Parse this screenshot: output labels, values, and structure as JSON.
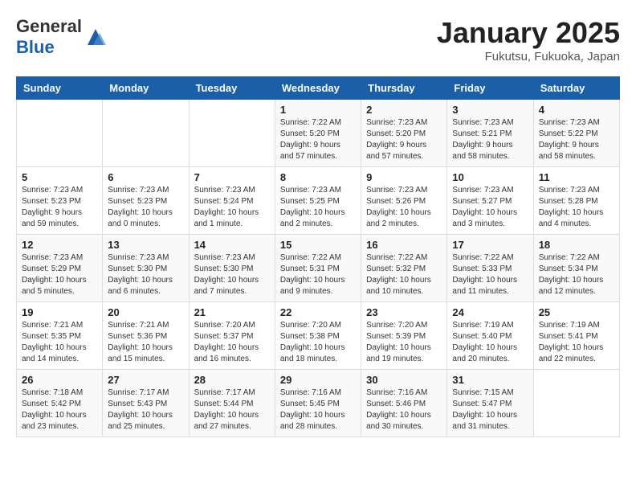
{
  "header": {
    "logo_general": "General",
    "logo_blue": "Blue",
    "month_title": "January 2025",
    "subtitle": "Fukutsu, Fukuoka, Japan"
  },
  "weekdays": [
    "Sunday",
    "Monday",
    "Tuesday",
    "Wednesday",
    "Thursday",
    "Friday",
    "Saturday"
  ],
  "weeks": [
    [
      {
        "day": "",
        "info": ""
      },
      {
        "day": "",
        "info": ""
      },
      {
        "day": "",
        "info": ""
      },
      {
        "day": "1",
        "info": "Sunrise: 7:22 AM\nSunset: 5:20 PM\nDaylight: 9 hours\nand 57 minutes."
      },
      {
        "day": "2",
        "info": "Sunrise: 7:23 AM\nSunset: 5:20 PM\nDaylight: 9 hours\nand 57 minutes."
      },
      {
        "day": "3",
        "info": "Sunrise: 7:23 AM\nSunset: 5:21 PM\nDaylight: 9 hours\nand 58 minutes."
      },
      {
        "day": "4",
        "info": "Sunrise: 7:23 AM\nSunset: 5:22 PM\nDaylight: 9 hours\nand 58 minutes."
      }
    ],
    [
      {
        "day": "5",
        "info": "Sunrise: 7:23 AM\nSunset: 5:23 PM\nDaylight: 9 hours\nand 59 minutes."
      },
      {
        "day": "6",
        "info": "Sunrise: 7:23 AM\nSunset: 5:23 PM\nDaylight: 10 hours\nand 0 minutes."
      },
      {
        "day": "7",
        "info": "Sunrise: 7:23 AM\nSunset: 5:24 PM\nDaylight: 10 hours\nand 1 minute."
      },
      {
        "day": "8",
        "info": "Sunrise: 7:23 AM\nSunset: 5:25 PM\nDaylight: 10 hours\nand 2 minutes."
      },
      {
        "day": "9",
        "info": "Sunrise: 7:23 AM\nSunset: 5:26 PM\nDaylight: 10 hours\nand 2 minutes."
      },
      {
        "day": "10",
        "info": "Sunrise: 7:23 AM\nSunset: 5:27 PM\nDaylight: 10 hours\nand 3 minutes."
      },
      {
        "day": "11",
        "info": "Sunrise: 7:23 AM\nSunset: 5:28 PM\nDaylight: 10 hours\nand 4 minutes."
      }
    ],
    [
      {
        "day": "12",
        "info": "Sunrise: 7:23 AM\nSunset: 5:29 PM\nDaylight: 10 hours\nand 5 minutes."
      },
      {
        "day": "13",
        "info": "Sunrise: 7:23 AM\nSunset: 5:30 PM\nDaylight: 10 hours\nand 6 minutes."
      },
      {
        "day": "14",
        "info": "Sunrise: 7:23 AM\nSunset: 5:30 PM\nDaylight: 10 hours\nand 7 minutes."
      },
      {
        "day": "15",
        "info": "Sunrise: 7:22 AM\nSunset: 5:31 PM\nDaylight: 10 hours\nand 9 minutes."
      },
      {
        "day": "16",
        "info": "Sunrise: 7:22 AM\nSunset: 5:32 PM\nDaylight: 10 hours\nand 10 minutes."
      },
      {
        "day": "17",
        "info": "Sunrise: 7:22 AM\nSunset: 5:33 PM\nDaylight: 10 hours\nand 11 minutes."
      },
      {
        "day": "18",
        "info": "Sunrise: 7:22 AM\nSunset: 5:34 PM\nDaylight: 10 hours\nand 12 minutes."
      }
    ],
    [
      {
        "day": "19",
        "info": "Sunrise: 7:21 AM\nSunset: 5:35 PM\nDaylight: 10 hours\nand 14 minutes."
      },
      {
        "day": "20",
        "info": "Sunrise: 7:21 AM\nSunset: 5:36 PM\nDaylight: 10 hours\nand 15 minutes."
      },
      {
        "day": "21",
        "info": "Sunrise: 7:20 AM\nSunset: 5:37 PM\nDaylight: 10 hours\nand 16 minutes."
      },
      {
        "day": "22",
        "info": "Sunrise: 7:20 AM\nSunset: 5:38 PM\nDaylight: 10 hours\nand 18 minutes."
      },
      {
        "day": "23",
        "info": "Sunrise: 7:20 AM\nSunset: 5:39 PM\nDaylight: 10 hours\nand 19 minutes."
      },
      {
        "day": "24",
        "info": "Sunrise: 7:19 AM\nSunset: 5:40 PM\nDaylight: 10 hours\nand 20 minutes."
      },
      {
        "day": "25",
        "info": "Sunrise: 7:19 AM\nSunset: 5:41 PM\nDaylight: 10 hours\nand 22 minutes."
      }
    ],
    [
      {
        "day": "26",
        "info": "Sunrise: 7:18 AM\nSunset: 5:42 PM\nDaylight: 10 hours\nand 23 minutes."
      },
      {
        "day": "27",
        "info": "Sunrise: 7:17 AM\nSunset: 5:43 PM\nDaylight: 10 hours\nand 25 minutes."
      },
      {
        "day": "28",
        "info": "Sunrise: 7:17 AM\nSunset: 5:44 PM\nDaylight: 10 hours\nand 27 minutes."
      },
      {
        "day": "29",
        "info": "Sunrise: 7:16 AM\nSunset: 5:45 PM\nDaylight: 10 hours\nand 28 minutes."
      },
      {
        "day": "30",
        "info": "Sunrise: 7:16 AM\nSunset: 5:46 PM\nDaylight: 10 hours\nand 30 minutes."
      },
      {
        "day": "31",
        "info": "Sunrise: 7:15 AM\nSunset: 5:47 PM\nDaylight: 10 hours\nand 31 minutes."
      },
      {
        "day": "",
        "info": ""
      }
    ]
  ]
}
